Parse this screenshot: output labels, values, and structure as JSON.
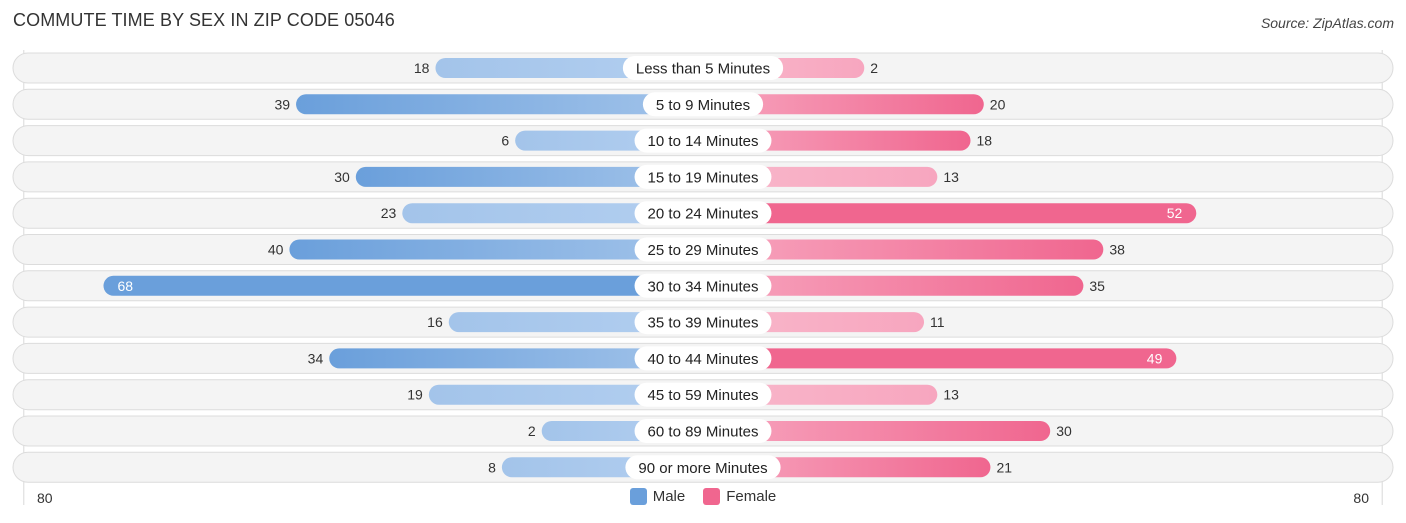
{
  "title": "COMMUTE TIME BY SEX IN ZIP CODE 05046",
  "source": "Source: ZipAtlas.com",
  "colors": {
    "male": "#6a9fdb",
    "male_light": "#a3c4ea",
    "female": "#f0668f",
    "female_light": "#f7a6bf"
  },
  "legend": [
    {
      "label": "Male",
      "color": "#6a9fdb"
    },
    {
      "label": "Female",
      "color": "#f0668f"
    }
  ],
  "chart_data": {
    "type": "bar",
    "orientation": "horizontal-diverging",
    "title": "COMMUTE TIME BY SEX IN ZIP CODE 05046",
    "categories": [
      "Less than 5 Minutes",
      "5 to 9 Minutes",
      "10 to 14 Minutes",
      "15 to 19 Minutes",
      "20 to 24 Minutes",
      "25 to 29 Minutes",
      "30 to 34 Minutes",
      "35 to 39 Minutes",
      "40 to 44 Minutes",
      "45 to 59 Minutes",
      "60 to 89 Minutes",
      "90 or more Minutes"
    ],
    "series": [
      {
        "name": "Male",
        "values": [
          18,
          39,
          6,
          30,
          23,
          40,
          68,
          16,
          34,
          19,
          2,
          8
        ]
      },
      {
        "name": "Female",
        "values": [
          2,
          20,
          18,
          13,
          52,
          38,
          35,
          11,
          49,
          13,
          30,
          21
        ]
      }
    ],
    "axis_min_label": "80",
    "axis_max_label": "80",
    "xlim": [
      -80,
      80
    ],
    "legend_position": "bottom-center",
    "grid": false
  }
}
